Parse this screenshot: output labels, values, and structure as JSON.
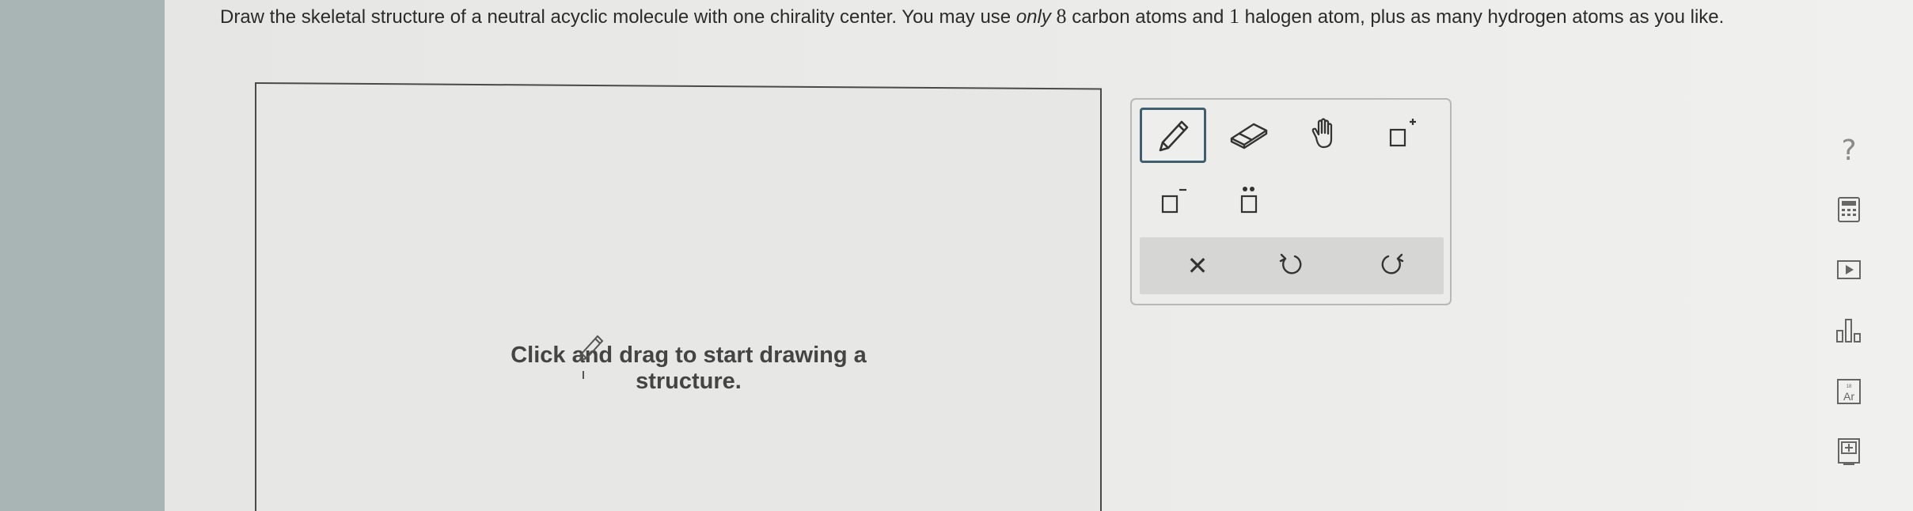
{
  "question": {
    "part1": "Draw the skeletal structure of a neutral acyclic molecule with one chirality center. You may use ",
    "emph": "only",
    "part2": " ",
    "carbon_count": "8",
    "part3": " carbon atoms and ",
    "halogen_count": "1",
    "part4": " halogen atom, plus as many hydrogen atoms as you like."
  },
  "canvas": {
    "hint_line1": "Click and drag to start drawing a",
    "hint_line2": "structure."
  },
  "toolbox": {
    "tools": [
      {
        "icon": "pencil-icon",
        "selected": true
      },
      {
        "icon": "eraser-icon",
        "selected": false
      },
      {
        "icon": "hand-icon",
        "selected": false
      },
      {
        "icon": "positive-charge-icon",
        "selected": false
      },
      {
        "icon": "negative-charge-icon",
        "selected": false
      },
      {
        "icon": "lone-pair-icon",
        "selected": false
      }
    ],
    "actions": [
      {
        "icon": "clear-icon",
        "glyph": "✕"
      },
      {
        "icon": "undo-icon"
      },
      {
        "icon": "redo-icon"
      }
    ]
  },
  "sidebar": {
    "help_glyph": "?",
    "icons": [
      "calculator-icon",
      "video-icon",
      "chart-icon",
      "periodic-table-icon",
      "textbook-icon"
    ]
  },
  "colors": {
    "left_strip": "#a9b5b4",
    "selected_border": "#3f5f70",
    "text": "#2b2b2b"
  }
}
